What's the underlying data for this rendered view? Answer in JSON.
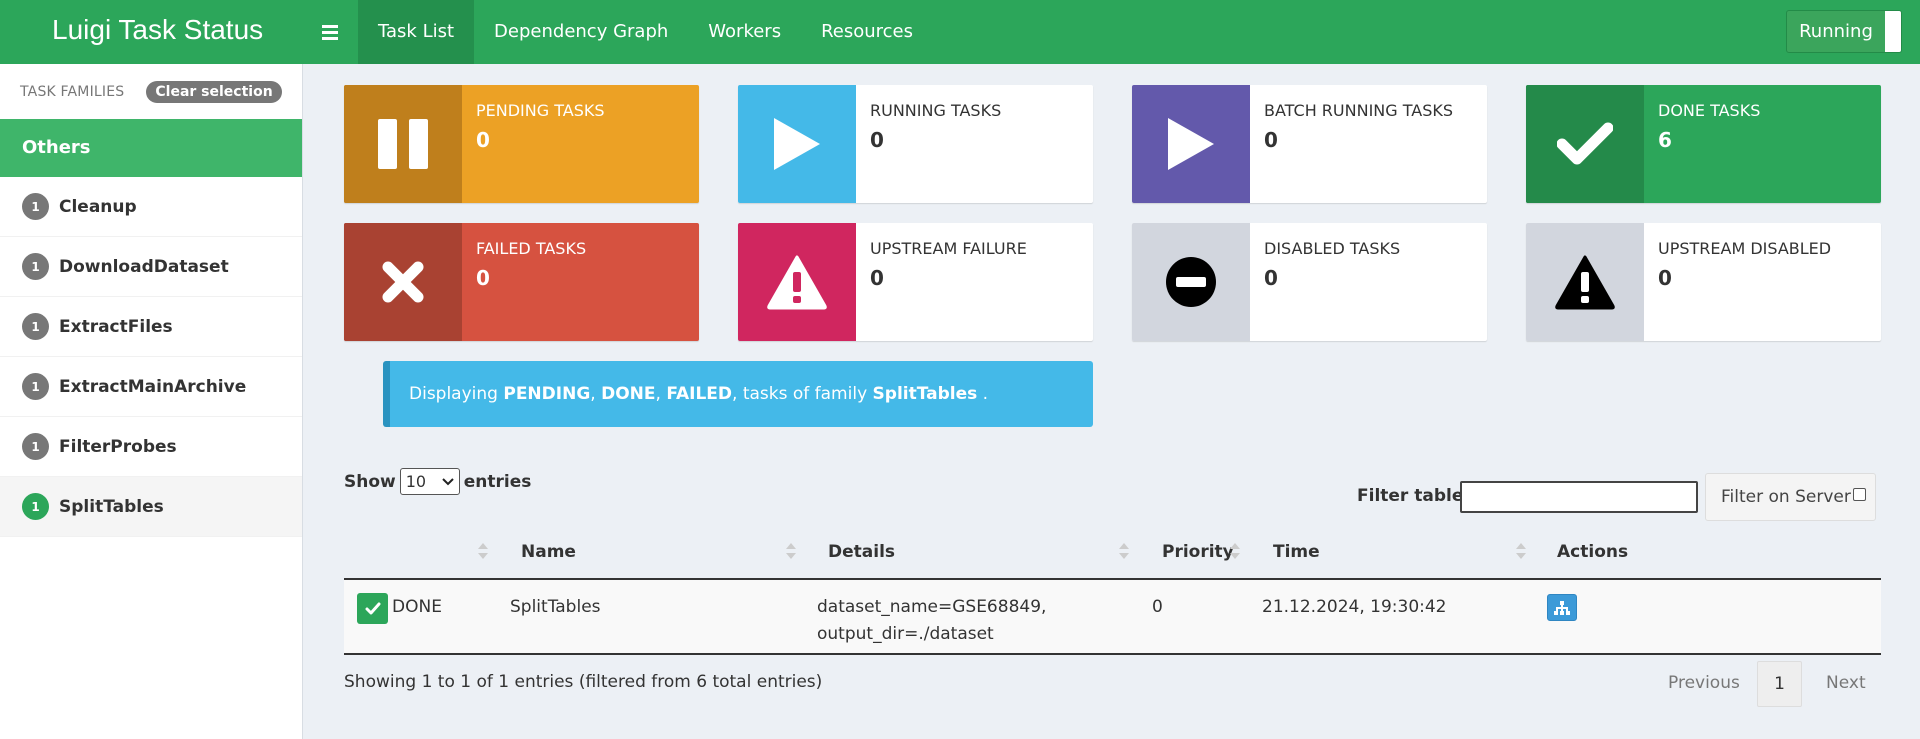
{
  "navbar": {
    "brand": "Luigi Task Status",
    "tabs": [
      "Task List",
      "Dependency Graph",
      "Workers",
      "Resources"
    ],
    "active_tab": "Task List",
    "running_label": "Running",
    "colors": {
      "navbar": "#2ca65a",
      "active_tab": "#24904d"
    }
  },
  "sidebar": {
    "families_label": "TASK FAMILIES",
    "clear_label": "Clear selection",
    "group_header": "Others",
    "items": [
      {
        "count": "1",
        "label": "Cleanup",
        "selected": false
      },
      {
        "count": "1",
        "label": "DownloadDataset",
        "selected": false
      },
      {
        "count": "1",
        "label": "ExtractFiles",
        "selected": false
      },
      {
        "count": "1",
        "label": "ExtractMainArchive",
        "selected": false
      },
      {
        "count": "1",
        "label": "FilterProbes",
        "selected": false
      },
      {
        "count": "1",
        "label": "SplitTables",
        "selected": true
      }
    ]
  },
  "status_boxes": {
    "pending": {
      "title": "PENDING TASKS",
      "count": "0",
      "icon": "pause-icon",
      "color": "#eca125"
    },
    "running": {
      "title": "RUNNING TASKS",
      "count": "0",
      "icon": "play-icon",
      "color": "#44b9e8"
    },
    "batch_running": {
      "title": "BATCH RUNNING TASKS",
      "count": "0",
      "icon": "play-icon",
      "color": "#6359ab"
    },
    "done": {
      "title": "DONE TASKS",
      "count": "6",
      "icon": "check-icon",
      "color": "#2ca65a"
    },
    "failed": {
      "title": "FAILED TASKS",
      "count": "0",
      "icon": "times-icon",
      "color": "#d65240"
    },
    "upstream_failure": {
      "title": "UPSTREAM FAILURE",
      "count": "0",
      "icon": "warning-icon",
      "color": "#d0265f"
    },
    "disabled": {
      "title": "DISABLED TASKS",
      "count": "0",
      "icon": "minus-circle-icon",
      "color": "#d2d6de"
    },
    "upstream_disabled": {
      "title": "UPSTREAM DISABLED",
      "count": "0",
      "icon": "warning-icon",
      "color": "#d2d6de"
    }
  },
  "alert": {
    "prefix": "Displaying ",
    "status1": "PENDING",
    "sep1": ", ",
    "status2": "DONE",
    "sep2": ", ",
    "status3": "FAILED",
    "mid": ", tasks of family ",
    "family": "SplitTables",
    "suffix": " ."
  },
  "table_controls": {
    "show_label": "Show",
    "entries_value": "10",
    "entries_label": "entries",
    "filter_label": "Filter table:",
    "filter_value": "",
    "server_filter_label": "Filter on Server"
  },
  "table": {
    "columns": [
      "",
      "Name",
      "Details",
      "Priority",
      "Time",
      "Actions"
    ],
    "rows": [
      {
        "status": "DONE",
        "name": "SplitTables",
        "details_line1": "dataset_name=GSE68849,",
        "details_line2": "output_dir=./dataset",
        "priority": "0",
        "time": "21.12.2024, 19:30:42",
        "action_icon": "dependency-graph-icon"
      }
    ]
  },
  "footer": {
    "info": "Showing 1 to 1 of 1 entries (filtered from 6 total entries)",
    "previous": "Previous",
    "page": "1",
    "next": "Next"
  }
}
